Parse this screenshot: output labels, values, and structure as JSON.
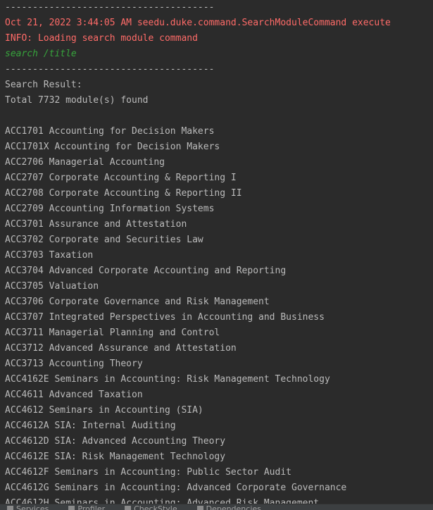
{
  "lines": [
    {
      "text": "--------------------------------------",
      "color": "gray"
    },
    {
      "text": "Oct 21, 2022 3:44:05 AM seedu.duke.command.SearchModuleCommand execute",
      "color": "red"
    },
    {
      "text": "INFO: Loading search module command",
      "color": "red"
    },
    {
      "text": "search /title",
      "color": "green"
    },
    {
      "text": "--------------------------------------",
      "color": "gray"
    },
    {
      "text": "Search Result:",
      "color": "gray"
    },
    {
      "text": "Total 7732 module(s) found",
      "color": "gray"
    },
    {
      "text": "",
      "color": "gray"
    },
    {
      "text": "ACC1701 Accounting for Decision Makers",
      "color": "gray"
    },
    {
      "text": "ACC1701X Accounting for Decision Makers",
      "color": "gray"
    },
    {
      "text": "ACC2706 Managerial Accounting",
      "color": "gray"
    },
    {
      "text": "ACC2707 Corporate Accounting & Reporting I",
      "color": "gray"
    },
    {
      "text": "ACC2708 Corporate Accounting & Reporting II",
      "color": "gray"
    },
    {
      "text": "ACC2709 Accounting Information Systems",
      "color": "gray"
    },
    {
      "text": "ACC3701 Assurance and Attestation",
      "color": "gray"
    },
    {
      "text": "ACC3702 Corporate and Securities Law",
      "color": "gray"
    },
    {
      "text": "ACC3703 Taxation",
      "color": "gray"
    },
    {
      "text": "ACC3704 Advanced Corporate Accounting and Reporting",
      "color": "gray"
    },
    {
      "text": "ACC3705 Valuation",
      "color": "gray"
    },
    {
      "text": "ACC3706 Corporate Governance and Risk Management",
      "color": "gray"
    },
    {
      "text": "ACC3707 Integrated Perspectives in Accounting and Business",
      "color": "gray"
    },
    {
      "text": "ACC3711 Managerial Planning and Control",
      "color": "gray"
    },
    {
      "text": "ACC3712 Advanced Assurance and Attestation",
      "color": "gray"
    },
    {
      "text": "ACC3713 Accounting Theory",
      "color": "gray"
    },
    {
      "text": "ACC4162E Seminars in Accounting: Risk Management Technology",
      "color": "gray"
    },
    {
      "text": "ACC4611 Advanced Taxation",
      "color": "gray"
    },
    {
      "text": "ACC4612 Seminars in Accounting (SIA)",
      "color": "gray"
    },
    {
      "text": "ACC4612A SIA: Internal Auditing",
      "color": "gray"
    },
    {
      "text": "ACC4612D SIA: Advanced Accounting Theory",
      "color": "gray"
    },
    {
      "text": "ACC4612E SIA: Risk Management Technology",
      "color": "gray"
    },
    {
      "text": "ACC4612F Seminars in Accounting: Public Sector Audit",
      "color": "gray"
    },
    {
      "text": "ACC4612G Seminars in Accounting: Advanced Corporate Governance",
      "color": "gray"
    },
    {
      "text": "ACC4612H Seminars in Accounting: Advanced Risk Management",
      "color": "gray"
    }
  ],
  "colors": {
    "background": "#2b2b2b",
    "text": "#bbbbbb",
    "log_red": "#ff6b68",
    "input_green": "#37a43c"
  },
  "statusbar": {
    "items": [
      {
        "label": "Services",
        "icon": "services-icon"
      },
      {
        "label": "Profiler",
        "icon": "profiler-icon"
      },
      {
        "label": "CheckStyle",
        "icon": "checkstyle-icon"
      },
      {
        "label": "Dependencies",
        "icon": "dependencies-icon"
      }
    ]
  }
}
